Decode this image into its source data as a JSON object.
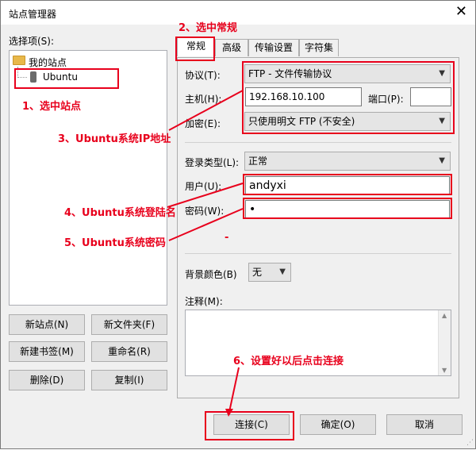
{
  "window": {
    "title": "站点管理器",
    "close_glyph": "✕"
  },
  "left": {
    "select_label": "选择项(S):",
    "tree": {
      "root": "我的站点",
      "site": "Ubuntu"
    },
    "buttons": {
      "new_site": "新站点(N)",
      "new_folder": "新文件夹(F)",
      "new_bookmark": "新建书签(M)",
      "rename": "重命名(R)",
      "delete": "删除(D)",
      "copy": "复制(I)"
    }
  },
  "tabs": [
    "常规",
    "高级",
    "传输设置",
    "字符集"
  ],
  "general": {
    "protocol_label": "协议(T):",
    "protocol_value": "FTP - 文件传输协议",
    "host_label": "主机(H):",
    "host_value": "192.168.10.100",
    "port_label": "端口(P):",
    "port_value": "",
    "encryption_label": "加密(E):",
    "encryption_value": "只使用明文 FTP (不安全)",
    "logon_label": "登录类型(L):",
    "logon_value": "正常",
    "user_label": "用户(U):",
    "user_value": "andyxi",
    "password_label": "密码(W):",
    "password_value": "•",
    "bgcolor_label": "背景颜色(B)",
    "bgcolor_value": "无",
    "comments_label": "注释(M):"
  },
  "footer": {
    "connect": "连接(C)",
    "ok": "确定(O)",
    "cancel": "取消"
  },
  "annotations": {
    "a1": "1、选中站点",
    "a2": "2、选中常规",
    "a3": "3、Ubuntu系统IP地址",
    "a4": "4、Ubuntu系统登陆名",
    "a5": "5、Ubuntu系统密码",
    "a6": "6、设置好以后点击连接",
    "dash": "-"
  },
  "colors": {
    "annotation": "#e8001c",
    "folder": "#e8b84a"
  }
}
